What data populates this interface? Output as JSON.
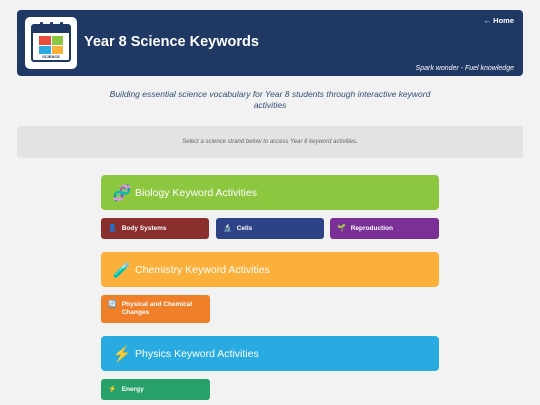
{
  "header": {
    "title": "Year 8 Science Keywords",
    "home_label": "← Home",
    "tagline": "Spark wonder - Fuel knowledge",
    "logo_text": "SCIENCE",
    "bg_color": "#1f3864"
  },
  "intro": "Building essential science vocabulary for Year 8 students through interactive keyword activities",
  "notice": "Select a science strand below to access Year 8 keyword activities.",
  "strands": [
    {
      "label": "Biology Keyword Activities",
      "icon": "dna-icon",
      "color": "#8dc63f",
      "topics": [
        {
          "label": "Body Systems",
          "icon": "person-icon",
          "color": "#8b2e2e"
        },
        {
          "label": "Cells",
          "icon": "microscope-icon",
          "color": "#2e4386"
        },
        {
          "label": "Reproduction",
          "icon": "seedling-icon",
          "color": "#7a3097"
        }
      ]
    },
    {
      "label": "Chemistry Keyword Activities",
      "icon": "test-tube-icon",
      "color": "#fbb03b",
      "topics": [
        {
          "label": "Physical and Chemical Changes",
          "icon": "cycle-icon",
          "color": "#f07f2a"
        }
      ]
    },
    {
      "label": "Physics Keyword Activities",
      "icon": "lightning-icon",
      "color": "#29abe2",
      "topics": [
        {
          "label": "Energy",
          "icon": "lightning-icon",
          "color": "#27a169"
        }
      ]
    }
  ]
}
